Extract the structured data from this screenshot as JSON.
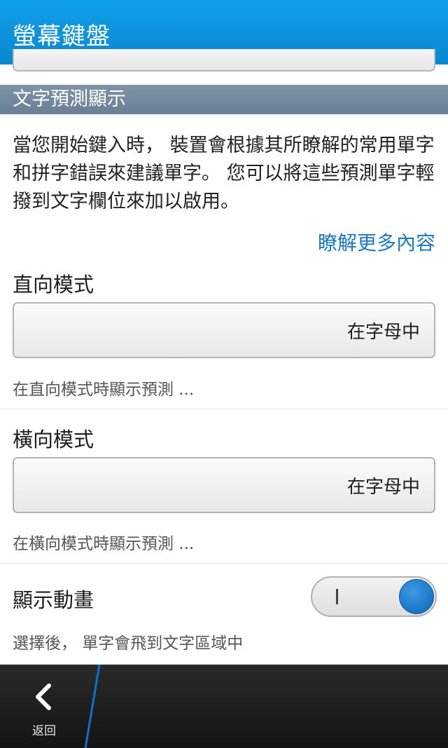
{
  "header": {
    "title": "螢幕鍵盤"
  },
  "section": {
    "title": "文字預測顯示"
  },
  "description": "當您開始鍵入時， 裝置會根據其所瞭解的常用單字和拼字錯誤來建議單字。 您可以將這些預測單字輕撥到文字欄位來加以啟用。",
  "learn_more": "瞭解更多內容",
  "portrait": {
    "label": "直向模式",
    "value": "在字母中",
    "hint": "在直向模式時顯示預測 ..."
  },
  "landscape": {
    "label": "橫向模式",
    "value": "在字母中",
    "hint": "在橫向模式時顯示預測 ..."
  },
  "animation": {
    "label": "顯示動畫",
    "hint": "選擇後， 單字會飛到文字區域中",
    "enabled": true
  },
  "bottom_bar": {
    "back_label": "返回"
  },
  "colors": {
    "title_bar": "#0a86cf",
    "section_header": "#6a7f95",
    "link": "#1a79c6",
    "toggle_on": "#0d67b8"
  }
}
